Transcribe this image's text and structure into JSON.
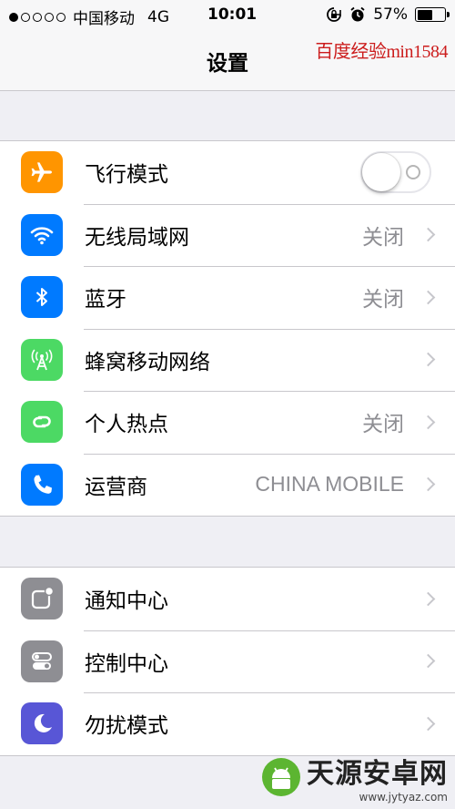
{
  "status_bar": {
    "signal_dots_filled": 1,
    "signal_dots_total": 5,
    "carrier": "中国移动",
    "network": "4G",
    "time": "10:01",
    "battery_percent": "57%",
    "battery_level": 0.57
  },
  "nav": {
    "title": "设置"
  },
  "watermark": "百度经验min1584",
  "groups": [
    {
      "rows": [
        {
          "icon": "airplane-icon",
          "icon_color": "#ff9500",
          "label": "飞行模式",
          "toggle": false
        },
        {
          "icon": "wifi-icon",
          "icon_color": "#007aff",
          "label": "无线局域网",
          "value": "关闭"
        },
        {
          "icon": "bluetooth-icon",
          "icon_color": "#007aff",
          "label": "蓝牙",
          "value": "关闭"
        },
        {
          "icon": "cellular-icon",
          "icon_color": "#4cd964",
          "label": "蜂窝移动网络",
          "value": ""
        },
        {
          "icon": "hotspot-icon",
          "icon_color": "#4cd964",
          "label": "个人热点",
          "value": "关闭"
        },
        {
          "icon": "phone-icon",
          "icon_color": "#007aff",
          "label": "运营商",
          "value": "CHINA MOBILE"
        }
      ]
    },
    {
      "rows": [
        {
          "icon": "notification-center-icon",
          "icon_color": "#8e8e93",
          "label": "通知中心"
        },
        {
          "icon": "control-center-icon",
          "icon_color": "#8e8e93",
          "label": "控制中心"
        },
        {
          "icon": "moon-icon",
          "icon_color": "#5856d6",
          "label": "勿扰模式"
        }
      ]
    }
  ],
  "site_logo": {
    "name": "天源安卓网",
    "url": "www.jytyaz.com"
  }
}
